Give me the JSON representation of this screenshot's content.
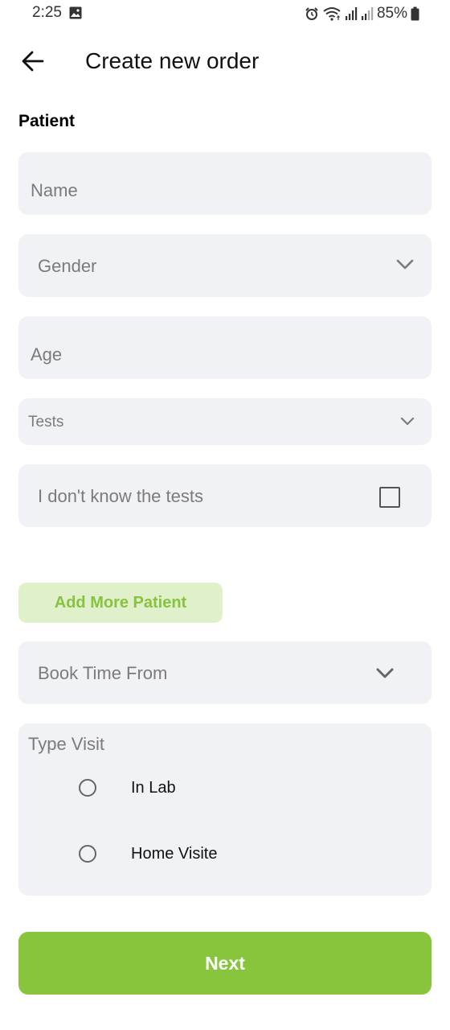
{
  "status_bar": {
    "time": "2:25",
    "battery": "85%",
    "icons": [
      "gallery-icon",
      "alarm-icon",
      "wifi-icon",
      "signal-icon",
      "signal-icon",
      "battery-icon"
    ]
  },
  "header": {
    "back_icon": "arrow-left-icon",
    "title": "Create new order"
  },
  "patient_section": {
    "label": "Patient",
    "name_placeholder": "Name",
    "gender_placeholder": "Gender",
    "age_placeholder": "Age",
    "tests_placeholder": "Tests",
    "unknown_tests_label": "I don't know the tests",
    "unknown_tests_checked": false
  },
  "add_more_label": "Add More Patient",
  "book_time_placeholder": "Book Time From",
  "visit_type": {
    "label": "Type Visit",
    "options": [
      {
        "label": "In Lab",
        "selected": false
      },
      {
        "label": "Home Visite",
        "selected": false
      }
    ]
  },
  "next_label": "Next",
  "colors": {
    "accent": "#88c53d",
    "accent_light": "#e0f0ca",
    "field_background": "#f1f2f6",
    "placeholder": "#7b7b7e"
  }
}
